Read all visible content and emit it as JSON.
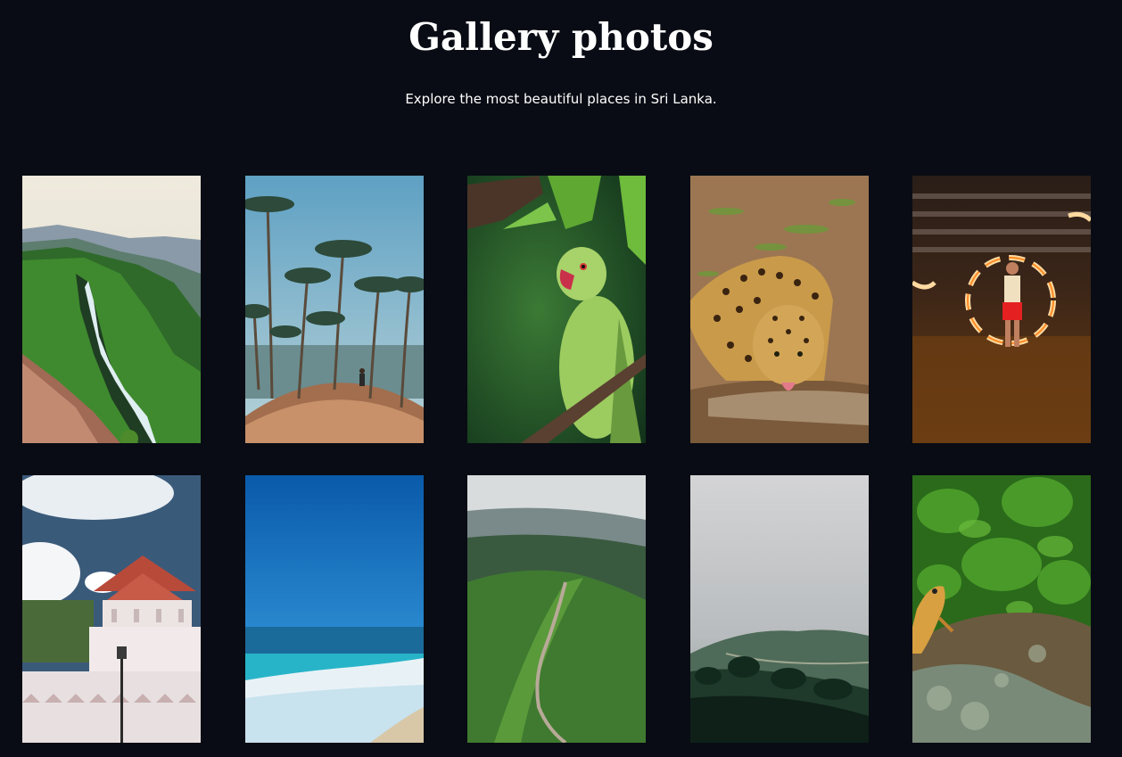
{
  "header": {
    "title": "Gallery photos",
    "subtitle": "Explore the most beautiful places in Sri Lanka."
  },
  "gallery": {
    "items": [
      {
        "name": "waterfall-cliff-photo",
        "icon": "mountain-waterfall-image"
      },
      {
        "name": "palm-trees-hill-photo",
        "icon": "palm-trees-image"
      },
      {
        "name": "green-parrot-photo",
        "icon": "parrot-image"
      },
      {
        "name": "leopard-drinking-photo",
        "icon": "leopard-image"
      },
      {
        "name": "fire-dancer-photo",
        "icon": "fire-dancer-image"
      },
      {
        "name": "temple-of-tooth-photo",
        "icon": "temple-image"
      },
      {
        "name": "ocean-beach-photo",
        "icon": "beach-image"
      },
      {
        "name": "mountain-road-photo",
        "icon": "winding-road-image"
      },
      {
        "name": "misty-forest-photo",
        "icon": "misty-hills-image"
      },
      {
        "name": "lizard-on-rock-photo",
        "icon": "lizard-image"
      }
    ]
  },
  "colors": {
    "background": "#090c14",
    "text": "#ffffff"
  }
}
